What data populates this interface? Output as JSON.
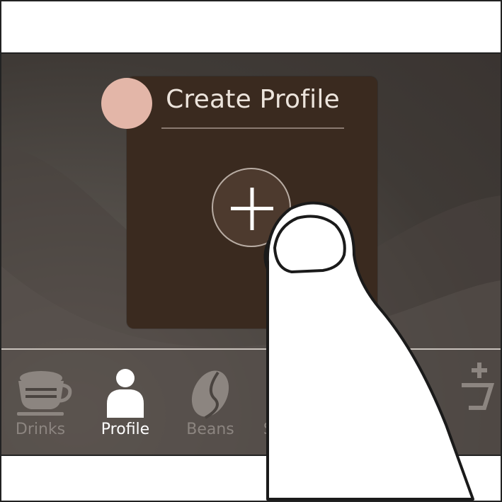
{
  "card": {
    "title": "Create Profile"
  },
  "tabs": [
    {
      "label": "Drinks",
      "icon": "coffee-cup-icon",
      "active": false
    },
    {
      "label": "Profile",
      "icon": "person-icon",
      "active": true
    },
    {
      "label": "Beans",
      "icon": "coffee-bean-icon",
      "active": false
    },
    {
      "label": "Settings",
      "icon": "gear-icon",
      "active": false
    },
    {
      "label": "",
      "icon": "add-drink-icon",
      "active": false
    }
  ],
  "colors": {
    "screen_bg": "#3f3a36",
    "card_bg": "#3a2a1f",
    "avatar": "#e3b6a8",
    "title_text": "#ece4dc",
    "tab_inactive": "#8c8580",
    "tab_active": "#ffffff"
  }
}
